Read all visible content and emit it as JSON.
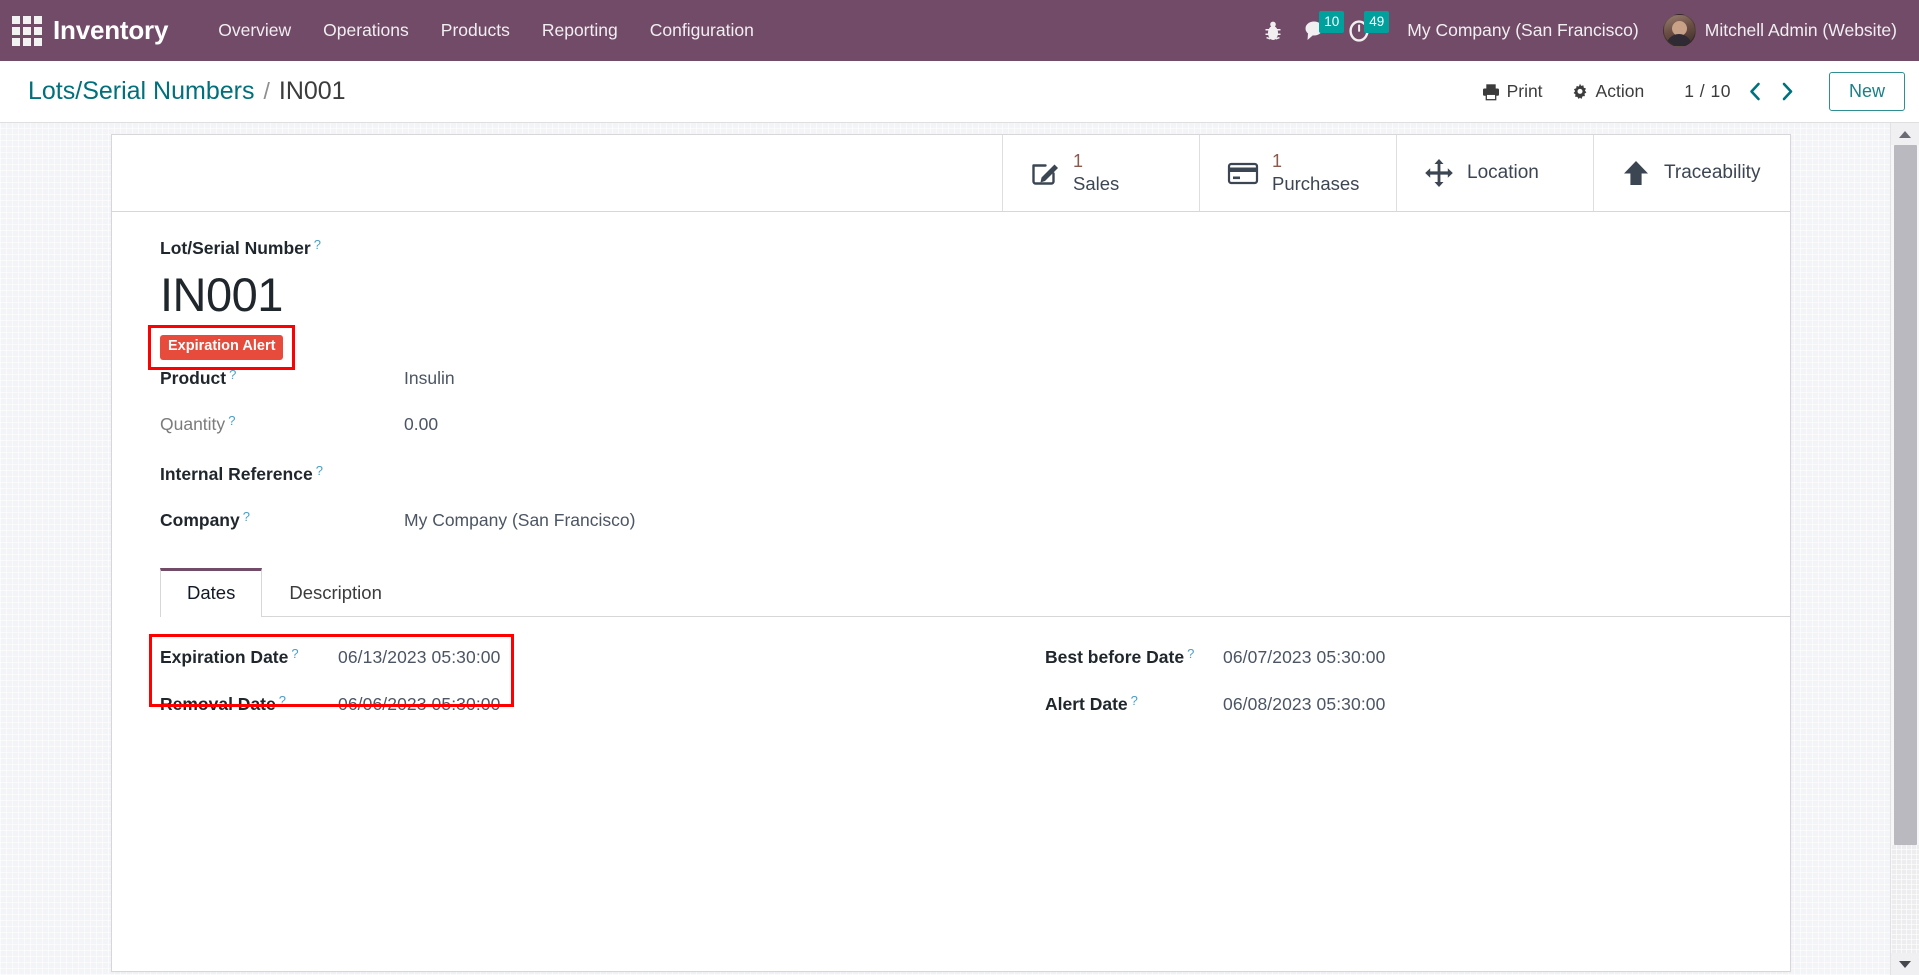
{
  "navbar": {
    "apps_icon": "apps-grid-icon",
    "brand": "Inventory",
    "menu": [
      {
        "label": "Overview"
      },
      {
        "label": "Operations"
      },
      {
        "label": "Products"
      },
      {
        "label": "Reporting"
      },
      {
        "label": "Configuration"
      }
    ],
    "systray": {
      "debug_icon": "bug-icon",
      "messaging_icon": "chat-bubble-icon",
      "messaging_count": "10",
      "activities_icon": "clock-icon",
      "activities_count": "49"
    },
    "company": "My Company (San Francisco)",
    "user": "Mitchell Admin (Website)",
    "avatar": "user-avatar"
  },
  "control_panel": {
    "breadcrumb_root": "Lots/Serial Numbers",
    "breadcrumb_separator": "/",
    "breadcrumb_current": "IN001",
    "print_icon": "printer-icon",
    "print_label": "Print",
    "action_icon": "gear-icon",
    "action_label": "Action",
    "pager": "1 / 10",
    "pager_prev_icon": "chevron-left-icon",
    "pager_next_icon": "chevron-right-icon",
    "new_label": "New"
  },
  "stat_buttons": [
    {
      "icon": "pencil-square-icon",
      "value": "1",
      "label": "Sales"
    },
    {
      "icon": "credit-card-icon",
      "value": "1",
      "label": "Purchases"
    },
    {
      "icon": "arrows-move-icon",
      "value": "",
      "label": "Location"
    },
    {
      "icon": "arrow-up-icon",
      "value": "",
      "label": "Traceability"
    }
  ],
  "form": {
    "title_label": "Lot/Serial Number",
    "title_value": "IN001",
    "expiration_alert_badge": "Expiration Alert",
    "tooltip_glyph": "?",
    "fields": [
      {
        "label": "Product",
        "value": "Insulin",
        "readonly": false
      },
      {
        "label": "Quantity",
        "value": "0.00",
        "readonly": true
      },
      {
        "label": "Internal Reference",
        "value": "",
        "readonly": false
      },
      {
        "label": "Company",
        "value": "My Company (San Francisco)",
        "readonly": false
      }
    ]
  },
  "notebook": {
    "tabs": [
      {
        "label": "Dates",
        "active": true
      },
      {
        "label": "Description",
        "active": false
      }
    ],
    "dates_left": [
      {
        "label": "Expiration Date",
        "value": "06/13/2023 05:30:00"
      },
      {
        "label": "Removal Date",
        "value": "06/06/2023 05:30:00"
      }
    ],
    "dates_right": [
      {
        "label": "Best before Date",
        "value": "06/07/2023 05:30:00"
      },
      {
        "label": "Alert Date",
        "value": "06/08/2023 05:30:00"
      }
    ]
  },
  "colors": {
    "brand_purple": "#714B67",
    "accent_teal": "#00707C",
    "badge_teal": "#00A09D",
    "danger_red": "#E74B3C",
    "highlight_red": "#FF0000",
    "stat_value_brown": "#8A5A4C"
  }
}
